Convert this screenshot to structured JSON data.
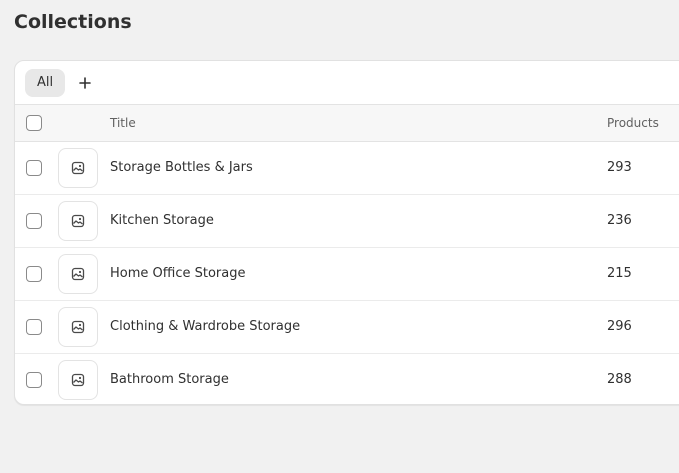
{
  "page": {
    "title": "Collections"
  },
  "tabs": [
    {
      "label": "All",
      "selected": true
    }
  ],
  "add_tab_icon": "plus-icon",
  "table": {
    "columns": [
      "Title",
      "Products"
    ],
    "rows": [
      {
        "title": "Storage Bottles & Jars",
        "products": "293"
      },
      {
        "title": "Kitchen Storage",
        "products": "236"
      },
      {
        "title": "Home Office Storage",
        "products": "215"
      },
      {
        "title": "Clothing & Wardrobe Storage",
        "products": "296"
      },
      {
        "title": "Bathroom Storage",
        "products": "288"
      }
    ]
  },
  "icons": {
    "thumbnail": "image-placeholder-icon"
  },
  "colors": {
    "page_background": "#f1f1f1",
    "card_background": "#ffffff",
    "header_background": "#f7f7f7",
    "text": "#303030",
    "muted_text": "#616161"
  }
}
